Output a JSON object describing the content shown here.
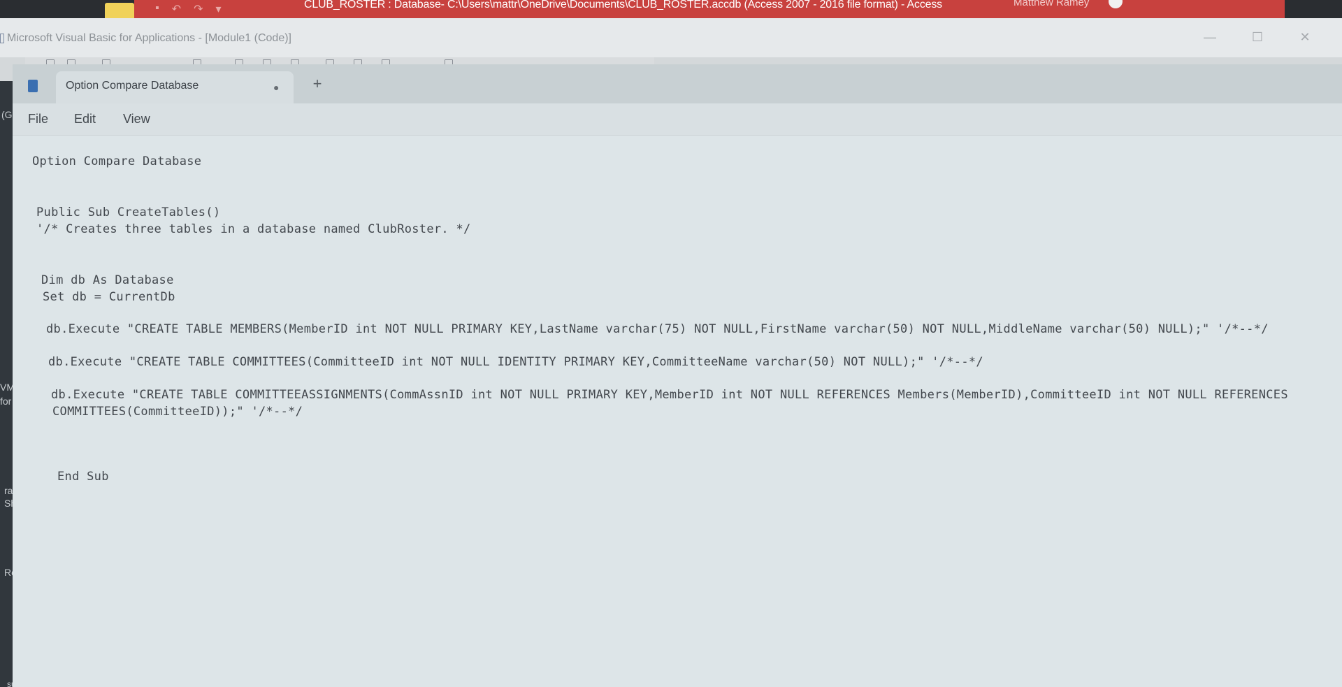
{
  "access": {
    "title": "CLUB_ROSTER : Database- C:\\Users\\mattr\\OneDrive\\Documents\\CLUB_ROSTER.accdb (Access 2007 - 2016 file format)  -  Access",
    "user": "Matthew Ramey"
  },
  "vba": {
    "title": "Microsoft Visual Basic for Applications - [Module1 (Code)]",
    "left_strip": [
      "(G",
      "VM",
      "for",
      "rap",
      "Sho",
      "Recy",
      "subli"
    ]
  },
  "notepad": {
    "tab_label": "Option Compare Database",
    "tab_unsaved_mark": "●",
    "new_tab": "+",
    "menu": [
      "File",
      "Edit",
      "View"
    ],
    "lines": [
      "Option Compare Database",
      "Public Sub CreateTables()",
      "'/* Creates three tables in a database named ClubRoster. */",
      "Dim db As Database",
      "Set db = CurrentDb",
      "db.Execute \"CREATE TABLE MEMBERS(MemberID int NOT NULL PRIMARY KEY,LastName varchar(75) NOT NULL,FirstName varchar(50) NOT NULL,MiddleName varchar(50) NULL);\" '/*--*/",
      "db.Execute \"CREATE TABLE COMMITTEES(CommitteeID int NOT NULL IDENTITY PRIMARY KEY,CommitteeName varchar(50) NOT NULL);\" '/*--*/",
      "db.Execute \"CREATE TABLE COMMITTEEASSIGNMENTS(CommAssnID int NOT NULL PRIMARY KEY,MemberID int NOT NULL REFERENCES Members(MemberID),CommitteeID int NOT NULL REFERENCES",
      "COMMITTEES(CommitteeID));\" '/*--*/",
      "End Sub"
    ]
  },
  "colors": {
    "access_accent": "#c8413e",
    "editor_background": "#dde5e8",
    "code_text": "#43484e"
  }
}
